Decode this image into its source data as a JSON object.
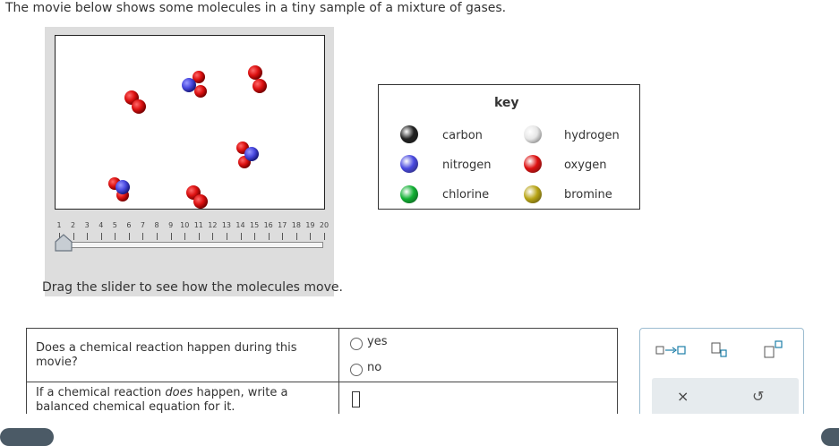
{
  "intro": "The movie below shows some molecules in a tiny sample of a mixture of gases.",
  "slider": {
    "ticks": [
      "1",
      "2",
      "3",
      "4",
      "5",
      "6",
      "7",
      "8",
      "9",
      "10",
      "11",
      "12",
      "13",
      "14",
      "15",
      "16",
      "17",
      "18",
      "19",
      "20"
    ],
    "current_frame": 1
  },
  "drag_instruction": "Drag the slider to see how the molecules move.",
  "key": {
    "title": "key",
    "items": [
      {
        "label": "carbon",
        "color": "#222222"
      },
      {
        "label": "hydrogen",
        "color": "#e6e6e6"
      },
      {
        "label": "nitrogen",
        "color": "#4a4ae0"
      },
      {
        "label": "oxygen",
        "color": "#dd1111"
      },
      {
        "label": "chlorine",
        "color": "#11b033"
      },
      {
        "label": "bromine",
        "color": "#b8a415"
      }
    ]
  },
  "questions": {
    "q1": "Does a chemical reaction happen during this movie?",
    "q2_prefix": "If a chemical reaction ",
    "q2_emph": "does",
    "q2_suffix": " happen, write a balanced chemical equation for it.",
    "options": [
      "yes",
      "no"
    ]
  },
  "tools": {
    "arrow_label": "□→□",
    "close_symbol": "×",
    "undo_symbol": "↺"
  },
  "colors": {
    "accent": "#9bbcd0",
    "oxygen": "#dd1111",
    "nitrogen": "#4a4ae0"
  }
}
